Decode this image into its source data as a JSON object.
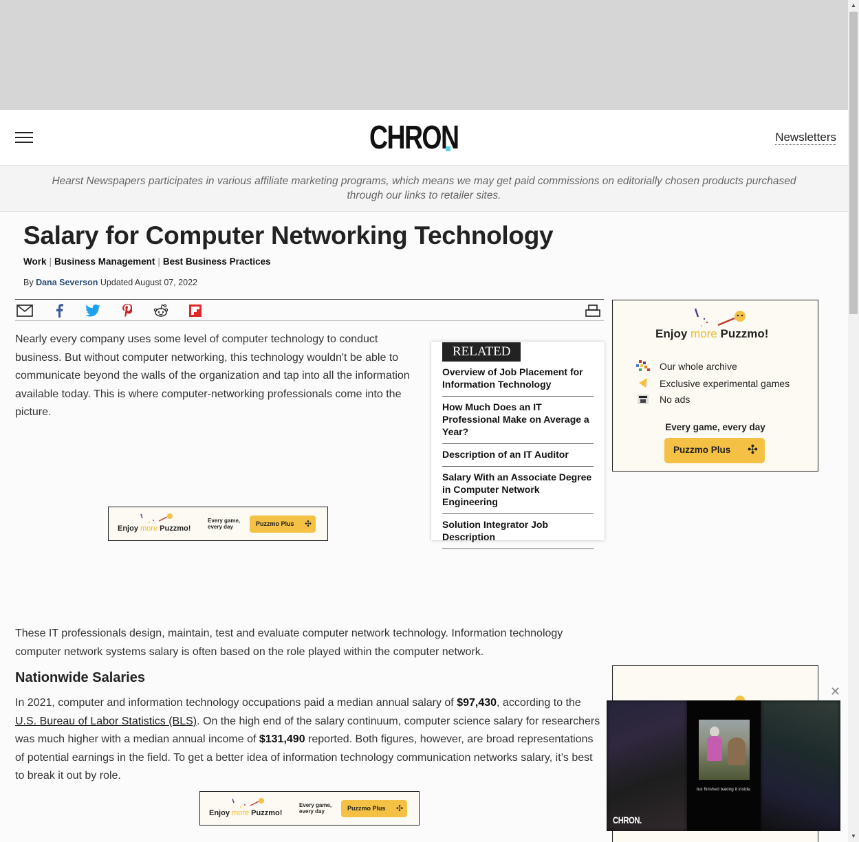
{
  "header": {
    "logo": "CHRON",
    "newsletters_label": "Newsletters"
  },
  "affiliate_notice": "Hearst Newspapers participates in various affiliate marketing programs, which means we may get paid commissions on editorially chosen products purchased through our links to retailer sites.",
  "article": {
    "title": "Salary for Computer Networking Technology",
    "breadcrumbs": [
      "Work",
      "Business Management",
      "Best Business Practices"
    ],
    "byline_prefix": "By",
    "author": "Dana Severson",
    "updated": "Updated August 07, 2022",
    "paragraph1": "Nearly every company uses some level of computer technology to conduct business. But without computer networking, this technology wouldn't be able to communicate beyond the walls of the organization and tap into all the information available today. This is where computer-networking professionals come into the picture.",
    "paragraph2": "These IT professionals design, maintain, test and evaluate computer network technology. Information technology computer network systems salary is often based on the role played within the computer network.",
    "section_heading": "Nationwide Salaries",
    "p3_a": "In 2021, computer and information technology occupations paid a median annual salary of ",
    "p3_b": "$97,430",
    "p3_c": ", according to the ",
    "p3_link": "U.S. Bureau of Labor Statistics (BLS)",
    "p3_d": ". On the high end of the salary continuum, computer science salary for researchers was much higher with a median annual income of ",
    "p3_e": "$131,490",
    "p3_f": " reported. Both figures, however, are broad representations of potential earnings in the field. To get a better idea of information technology communication networks salary, it’s best to break it out by role."
  },
  "share_icons": [
    "email-icon",
    "facebook-icon",
    "twitter-icon",
    "pinterest-icon",
    "reddit-icon",
    "flipboard-icon",
    "print-icon"
  ],
  "related": {
    "label": "RELATED",
    "items": [
      "Overview of Job Placement for Information Technology",
      "How Much Does an IT Professional Make on Average a Year?",
      "Description of an IT Auditor",
      "Salary With an Associate Degree in Computer Network Engineering",
      "Solution Integrator Job Description"
    ]
  },
  "puzzmo_banner": {
    "enjoy": "Enjoy",
    "more": "more",
    "puzzmo": "Puzzmo!",
    "every_line1": "Every game,",
    "every_line2": "every day",
    "button": "Puzzmo Plus"
  },
  "puzzmo_side": {
    "enjoy": "Enjoy",
    "more": "more",
    "puzzmo": "Puzzmo!",
    "features": [
      "Our whole archive",
      "Exclusive experimental games",
      "No ads"
    ],
    "every": "Every game, every day",
    "button": "Puzzmo Plus"
  },
  "video": {
    "caption": "but finished baking it inside.",
    "logo": "CHRON."
  },
  "colors": {
    "accent": "#5bd2ea",
    "puzzmo_yellow": "#f4c144",
    "author_link": "#2a4f7a"
  }
}
